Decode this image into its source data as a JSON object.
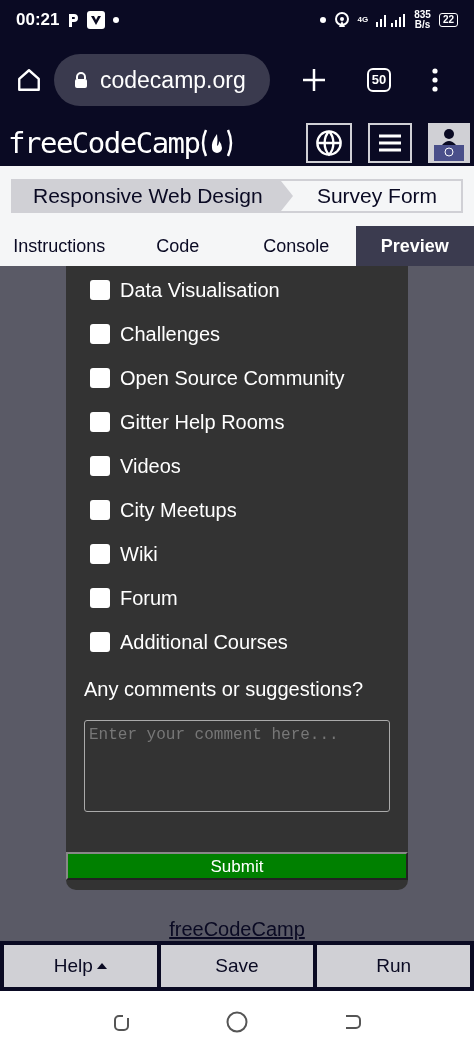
{
  "status_bar": {
    "time": "00:21",
    "network": "4G",
    "speed": "835",
    "speed_unit": "B/s",
    "battery": "22"
  },
  "browser": {
    "url": "codecamp.org",
    "tab_count": "50"
  },
  "site_nav": {
    "logo": "freeCodeCamp"
  },
  "breadcrumb": [
    "Responsive Web Design",
    "Survey Form"
  ],
  "tabs": [
    {
      "label": "Instructions",
      "selected": false
    },
    {
      "label": "Code",
      "selected": false
    },
    {
      "label": "Console",
      "selected": false
    },
    {
      "label": "Preview",
      "selected": true
    }
  ],
  "form": {
    "options": [
      {
        "label": "Data Visualisation",
        "checked": false
      },
      {
        "label": "Challenges",
        "checked": false
      },
      {
        "label": "Open Source Community",
        "checked": false
      },
      {
        "label": "Gitter Help Rooms",
        "checked": false
      },
      {
        "label": "Videos",
        "checked": false
      },
      {
        "label": "City Meetups",
        "checked": false
      },
      {
        "label": "Wiki",
        "checked": false
      },
      {
        "label": "Forum",
        "checked": false
      },
      {
        "label": "Additional Courses",
        "checked": false
      }
    ],
    "comments_label": "Any comments or suggestions?",
    "comments_placeholder": "Enter your comment here...",
    "submit": "Submit"
  },
  "footer_link": "freeCodeCamp",
  "actions": [
    "Help",
    "Save",
    "Run"
  ]
}
